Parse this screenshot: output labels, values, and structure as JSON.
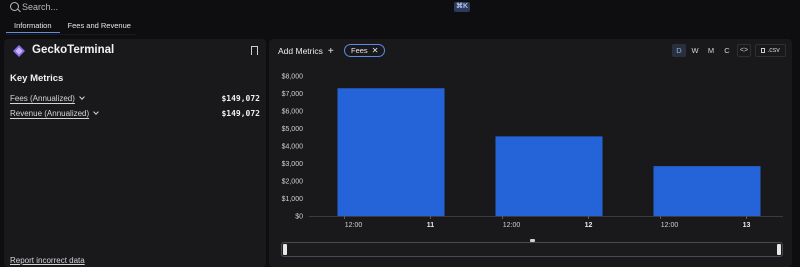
{
  "search": {
    "placeholder": "Search...",
    "shortcut": "⌘K"
  },
  "tabs": [
    {
      "label": "Information",
      "active": true
    },
    {
      "label": "Fees and Revenue",
      "active": false
    }
  ],
  "entity": {
    "name": "GeckoTerminal",
    "logo_color": "#8b6cf0"
  },
  "key_metrics": {
    "title": "Key Metrics",
    "rows": [
      {
        "label": "Fees (Annualized)",
        "value": "$149,072"
      },
      {
        "label": "Revenue (Annualized)",
        "value": "$149,072"
      }
    ]
  },
  "report_link": "Report incorrect data",
  "chart_toolbar": {
    "add_metrics": "Add Metrics",
    "plus": "+",
    "chip": "Fees",
    "chip_close": "✕",
    "periods": [
      {
        "label": "D",
        "active": true
      },
      {
        "label": "W",
        "active": false
      },
      {
        "label": "M",
        "active": false
      },
      {
        "label": "C",
        "active": false
      }
    ],
    "embed": "<>",
    "csv": ".csv"
  },
  "colors": {
    "bar": "#2563d8",
    "accent": "#5f8de8"
  },
  "chart_data": {
    "type": "bar",
    "series": [
      {
        "values": [
          7300,
          4550,
          2850
        ]
      }
    ],
    "bar_groups": [
      {
        "time_label": "12:00",
        "day_label": "11"
      },
      {
        "time_label": "12:00",
        "day_label": "12"
      },
      {
        "time_label": "12:00",
        "day_label": "13"
      }
    ],
    "y_ticks": [
      "$0",
      "$1,000",
      "$2,000",
      "$3,000",
      "$4,000",
      "$5,000",
      "$6,000",
      "$7,000",
      "$8,000"
    ],
    "ylim": [
      0,
      8000
    ],
    "grid": false
  }
}
